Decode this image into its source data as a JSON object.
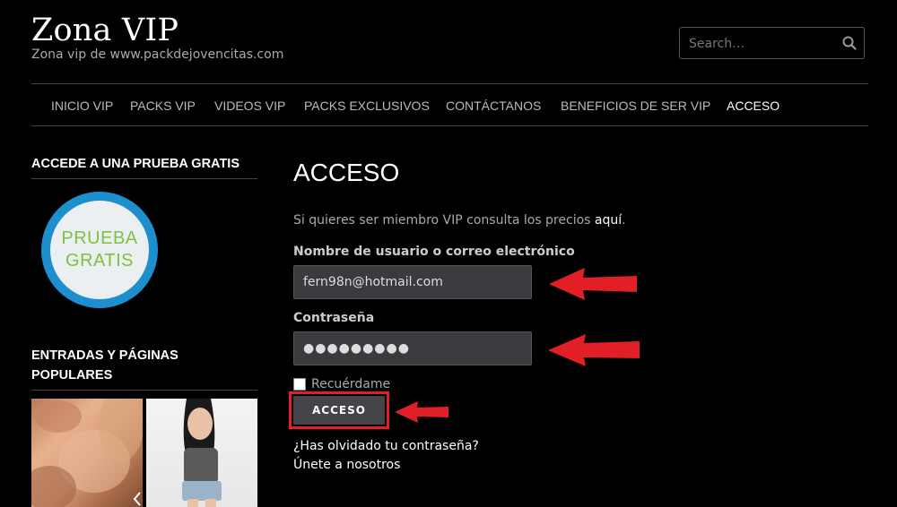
{
  "header": {
    "site_title": "Zona VIP",
    "site_description": "Zona vip de www.packdejovencitas.com",
    "search_placeholder": "Search…"
  },
  "nav": {
    "items": [
      {
        "label": "INICIO VIP"
      },
      {
        "label": "PACKS VIP"
      },
      {
        "label": "VIDEOS VIP"
      },
      {
        "label": "PACKS EXCLUSIVOS"
      },
      {
        "label": "CONTÁCTANOS"
      },
      {
        "label": "BENEFICIOS DE SER VIP"
      },
      {
        "label": "ACCESO"
      }
    ],
    "active": "ACCESO"
  },
  "sidebar": {
    "trial_title": "ACCEDE A UNA PRUEBA GRATIS",
    "trial_badge_line1": "PRUEBA",
    "trial_badge_line2": "GRATIS",
    "popular_title_line1": "ENTRADAS Y PÁGINAS",
    "popular_title_line2": "POPULARES"
  },
  "main": {
    "title": "ACCESO",
    "intro_text": "Si quieres ser miembro VIP consulta los precios ",
    "intro_link": "aquí",
    "intro_end": ".",
    "username_label": "Nombre de usuario o correo electrónico",
    "username_value": "fern98n@hotmail.com",
    "password_label": "Contraseña",
    "password_value": "●●●●●●●●●",
    "remember_label": "Recuérdame",
    "submit_label": "ACCESO",
    "forgot_link": "¿Has olvidado tu contraseña?",
    "register_link": "Únete a nosotros"
  },
  "colors": {
    "annotation_red": "#e21f26",
    "badge_blue": "#1e8fce",
    "badge_green": "#7cc242"
  }
}
